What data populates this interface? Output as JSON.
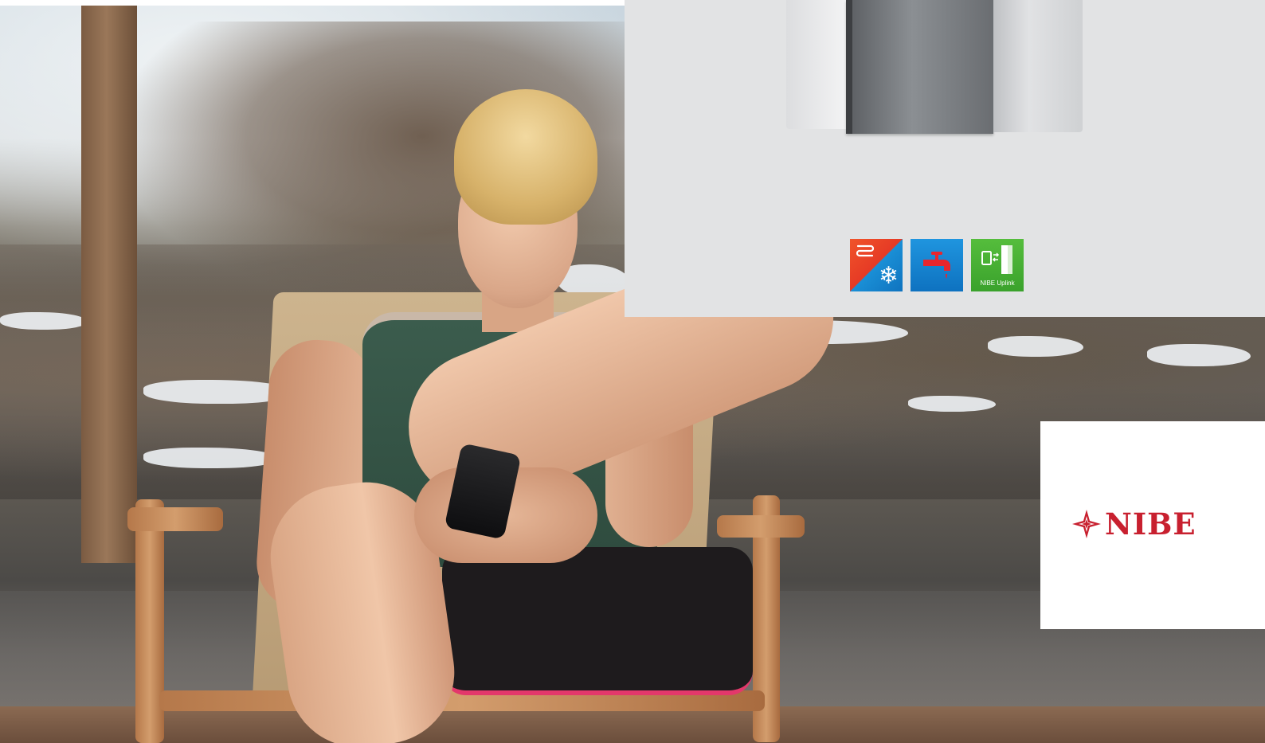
{
  "brand": {
    "logo_text": "NIBE",
    "color": "#c8202f"
  },
  "colors": {
    "panel_background": "#e2e3e4",
    "logo_card_background": "#ffffff",
    "climate_icon_warm": "#e63a25",
    "climate_icon_cool": "#0f73bf",
    "water_icon": "#1a86d2",
    "uplink_icon": "#45ad33"
  },
  "feature_icons": [
    {
      "name": "heating-cooling-icon",
      "label": ""
    },
    {
      "name": "hot-water-tap-icon",
      "label": ""
    },
    {
      "name": "nibe-uplink-icon",
      "label": "NIBE Uplink"
    }
  ],
  "photo": {
    "subject": "person-in-chair-with-phone"
  },
  "product": {
    "name": "heat-pump-unit"
  }
}
